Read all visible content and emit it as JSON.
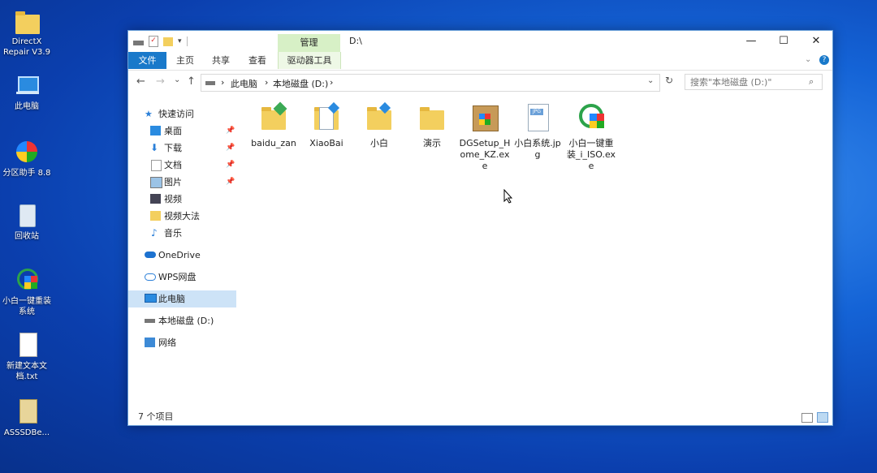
{
  "desktop": {
    "icons": [
      {
        "label": "DirectX Repair V3.9"
      },
      {
        "label": "此电脑"
      },
      {
        "label": "分区助手 8.8"
      },
      {
        "label": "回收站"
      },
      {
        "label": "小白一键重装系统"
      },
      {
        "label": "新建文本文档.txt"
      },
      {
        "label": "ASSSDBe..."
      }
    ]
  },
  "window": {
    "title_path": "D:\\",
    "contextual_tab_group": "管理",
    "ribbon_tabs": [
      "文件",
      "主页",
      "共享",
      "查看",
      "驱动器工具"
    ],
    "controls": {
      "minimize": "—",
      "maximize": "☐",
      "close": "✕"
    }
  },
  "address": {
    "back": "←",
    "forward": "→",
    "recent": "⌄",
    "up": "↑",
    "crumbs": [
      "此电脑",
      "本地磁盘 (D:)"
    ],
    "separator": "›",
    "search_placeholder": "搜索\"本地磁盘 (D:)\""
  },
  "sidebar": {
    "items": [
      {
        "label": "快速访问",
        "icon": "star-icon"
      },
      {
        "label": "桌面",
        "icon": "desktop-icon",
        "pinned": true
      },
      {
        "label": "下载",
        "icon": "download-icon",
        "pinned": true
      },
      {
        "label": "文档",
        "icon": "document-icon",
        "pinned": true
      },
      {
        "label": "图片",
        "icon": "picture-icon",
        "pinned": true
      },
      {
        "label": "视频",
        "icon": "video-icon"
      },
      {
        "label": "视频大法",
        "icon": "folder-icon"
      },
      {
        "label": "音乐",
        "icon": "music-icon"
      },
      {
        "label": "OneDrive",
        "icon": "cloud-icon"
      },
      {
        "label": "WPS网盘",
        "icon": "cloud-outline-icon"
      },
      {
        "label": "此电脑",
        "icon": "computer-icon",
        "selected": true
      },
      {
        "label": "本地磁盘 (D:)",
        "icon": "drive-icon"
      },
      {
        "label": "网络",
        "icon": "network-icon"
      }
    ]
  },
  "files": [
    {
      "name": "baidu_zan",
      "icon": "folder-green-arrow-icon"
    },
    {
      "name": "XiaoBai",
      "icon": "folder-files-icon"
    },
    {
      "name": "小白",
      "icon": "folder-arrow-icon"
    },
    {
      "name": "演示",
      "icon": "folder-icon"
    },
    {
      "name": "DGSetup_Home_KZ.exe",
      "icon": "installer-box-icon"
    },
    {
      "name": "小白系统.jpg",
      "icon": "jpg-file-icon"
    },
    {
      "name": "小白一键重装_i_ISO.exe",
      "icon": "reinstall-app-icon"
    }
  ],
  "status": {
    "count": "7 个项目"
  },
  "colors": {
    "accent": "#1979ca",
    "contextual": "#d7f0c6",
    "selected": "#cde3f7",
    "folder": "#f3cf5e"
  }
}
